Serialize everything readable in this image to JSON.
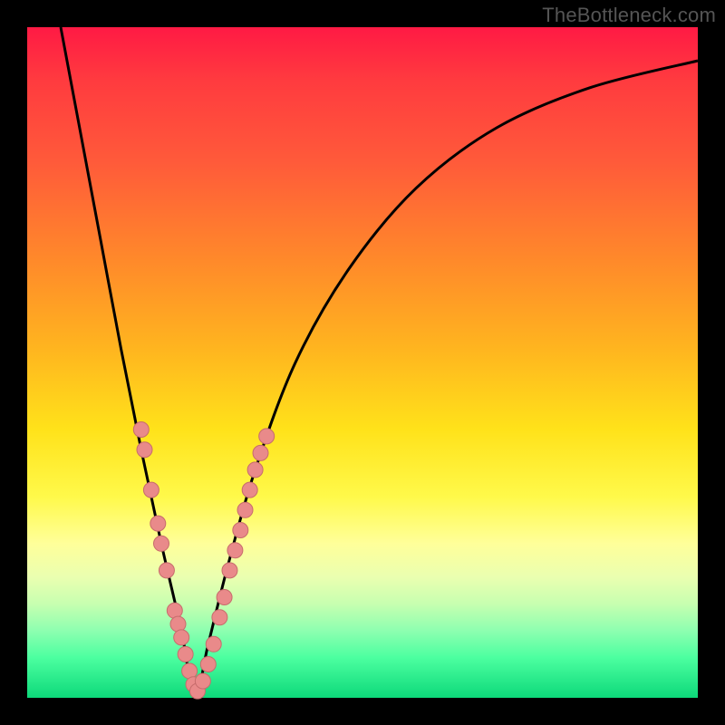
{
  "watermark": "TheBottleneck.com",
  "colors": {
    "frame": "#000000",
    "curve": "#000000",
    "marker_fill": "#e98a8a",
    "marker_stroke": "#c76c6c"
  },
  "chart_data": {
    "type": "line",
    "title": "",
    "xlabel": "",
    "ylabel": "",
    "xlim": [
      0,
      100
    ],
    "ylim": [
      0,
      100
    ],
    "grid": false,
    "legend": false,
    "note": "Qualitative bottleneck curve; gradient background encodes bottleneck severity from high (red, top) to none (green, bottom). Valley minimum ≈ x 25, y 0.",
    "series": [
      {
        "name": "bottleneck-curve",
        "x": [
          5,
          8,
          11,
          14,
          17,
          20,
          23,
          25,
          27,
          30,
          34,
          40,
          48,
          58,
          70,
          84,
          100
        ],
        "y": [
          100,
          84,
          68,
          52,
          37,
          23,
          10,
          0,
          8,
          20,
          34,
          50,
          64,
          76,
          85,
          91,
          95
        ]
      }
    ],
    "markers": {
      "name": "highlighted-points",
      "note": "Salmon bead markers clustered along both branches near the valley",
      "points": [
        {
          "x": 17,
          "y": 40
        },
        {
          "x": 17.5,
          "y": 37
        },
        {
          "x": 18.5,
          "y": 31
        },
        {
          "x": 19.5,
          "y": 26
        },
        {
          "x": 20,
          "y": 23
        },
        {
          "x": 20.8,
          "y": 19
        },
        {
          "x": 22,
          "y": 13
        },
        {
          "x": 22.5,
          "y": 11
        },
        {
          "x": 23,
          "y": 9
        },
        {
          "x": 23.6,
          "y": 6.5
        },
        {
          "x": 24.2,
          "y": 4
        },
        {
          "x": 24.8,
          "y": 2
        },
        {
          "x": 25.4,
          "y": 1
        },
        {
          "x": 26.2,
          "y": 2.5
        },
        {
          "x": 27,
          "y": 5
        },
        {
          "x": 27.8,
          "y": 8
        },
        {
          "x": 28.7,
          "y": 12
        },
        {
          "x": 29.4,
          "y": 15
        },
        {
          "x": 30.2,
          "y": 19
        },
        {
          "x": 31,
          "y": 22
        },
        {
          "x": 31.8,
          "y": 25
        },
        {
          "x": 32.5,
          "y": 28
        },
        {
          "x": 33.2,
          "y": 31
        },
        {
          "x": 34,
          "y": 34
        },
        {
          "x": 34.8,
          "y": 36.5
        },
        {
          "x": 35.7,
          "y": 39
        }
      ]
    }
  }
}
